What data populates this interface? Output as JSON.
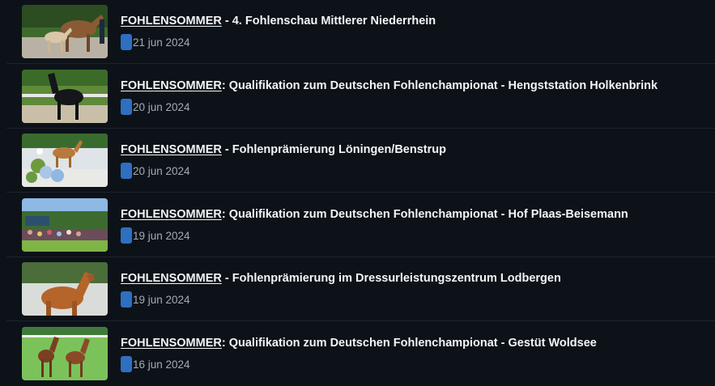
{
  "articles": [
    {
      "category": "FOHLENSOMMER",
      "rest": " - 4. Fohlenschau Mittlerer Niederrhein",
      "date": "21 jun 2024",
      "image": "foal-with-mare-photo",
      "calendar_icon": "calendar-icon"
    },
    {
      "category": "FOHLENSOMMER",
      "rest": ": Qualifikation zum Deutschen Fohlenchampionat - Hengststation Holkenbrink",
      "date": "20 jun 2024",
      "image": "black-foal-photo",
      "calendar_icon": "calendar-icon"
    },
    {
      "category": "FOHLENSOMMER",
      "rest": " - Fohlenprämierung Löningen/Benstrup",
      "date": "20 jun 2024",
      "image": "chestnut-foal-flowers-photo",
      "calendar_icon": "calendar-icon"
    },
    {
      "category": "FOHLENSOMMER",
      "rest": ": Qualifikation zum Deutschen Fohlenchampionat - Hof Plaas-Beisemann",
      "date": "19 jun 2024",
      "image": "spectators-photo",
      "calendar_icon": "calendar-icon"
    },
    {
      "category": "FOHLENSOMMER",
      "rest": " - Fohlenprämierung im Dressurleistungszentrum Lodbergen",
      "date": "19 jun 2024",
      "image": "chestnut-foal-photo",
      "calendar_icon": "calendar-icon"
    },
    {
      "category": "FOHLENSOMMER",
      "rest": ": Qualifikation zum Deutschen Fohlenchampionat - Gestüt Woldsee",
      "date": "16 jun 2024",
      "image": "two-foals-photo",
      "calendar_icon": "calendar-icon"
    }
  ],
  "colors": {
    "background": "#0d1219",
    "accent": "#2f6fc0",
    "title": "#f3f5f7",
    "date": "#a3abb5"
  }
}
